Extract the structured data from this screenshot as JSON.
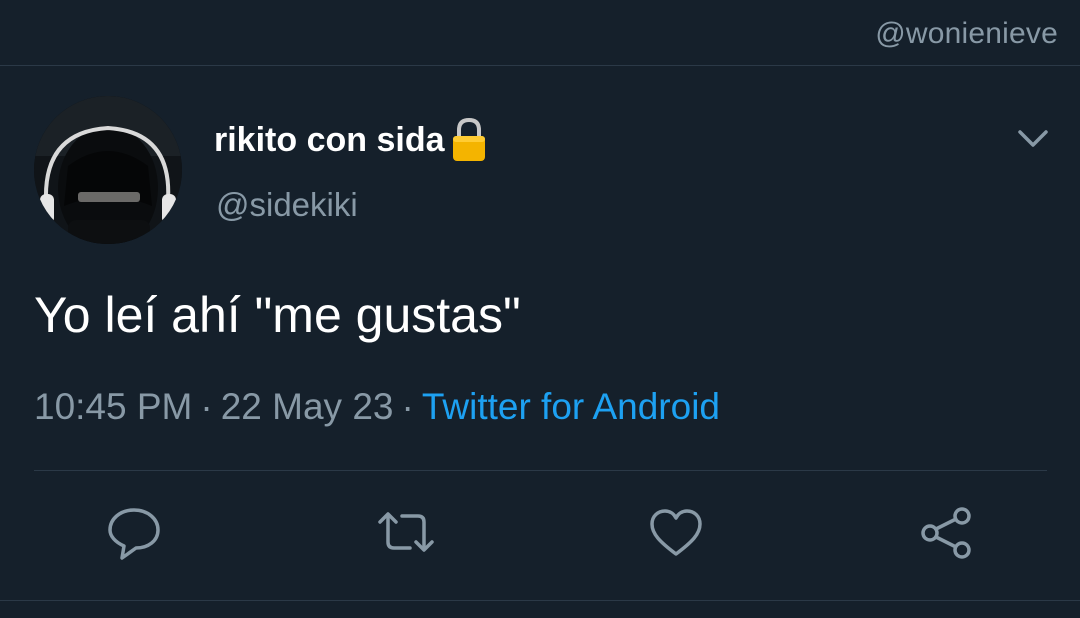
{
  "watermark": {
    "handle": "@wonienieve"
  },
  "tweet": {
    "author": {
      "display_name": "rikito con sida",
      "handle": "@sidekiki",
      "protected_icon": "lock-icon"
    },
    "text": "Yo leí ahí \"me gustas\"",
    "time": "10:45 PM",
    "separator": "·",
    "date": "22 May 23",
    "source": "Twitter for Android"
  },
  "actions": {
    "reply_icon": "comment-icon",
    "retweet_icon": "retweet-icon",
    "like_icon": "heart-icon",
    "share_icon": "share-icon"
  },
  "colors": {
    "background": "#15202b",
    "primary_text": "#ffffff",
    "secondary_text": "#8899a6",
    "accent": "#1da1f2",
    "divider": "#2b3947",
    "lock": "#f4b400"
  }
}
